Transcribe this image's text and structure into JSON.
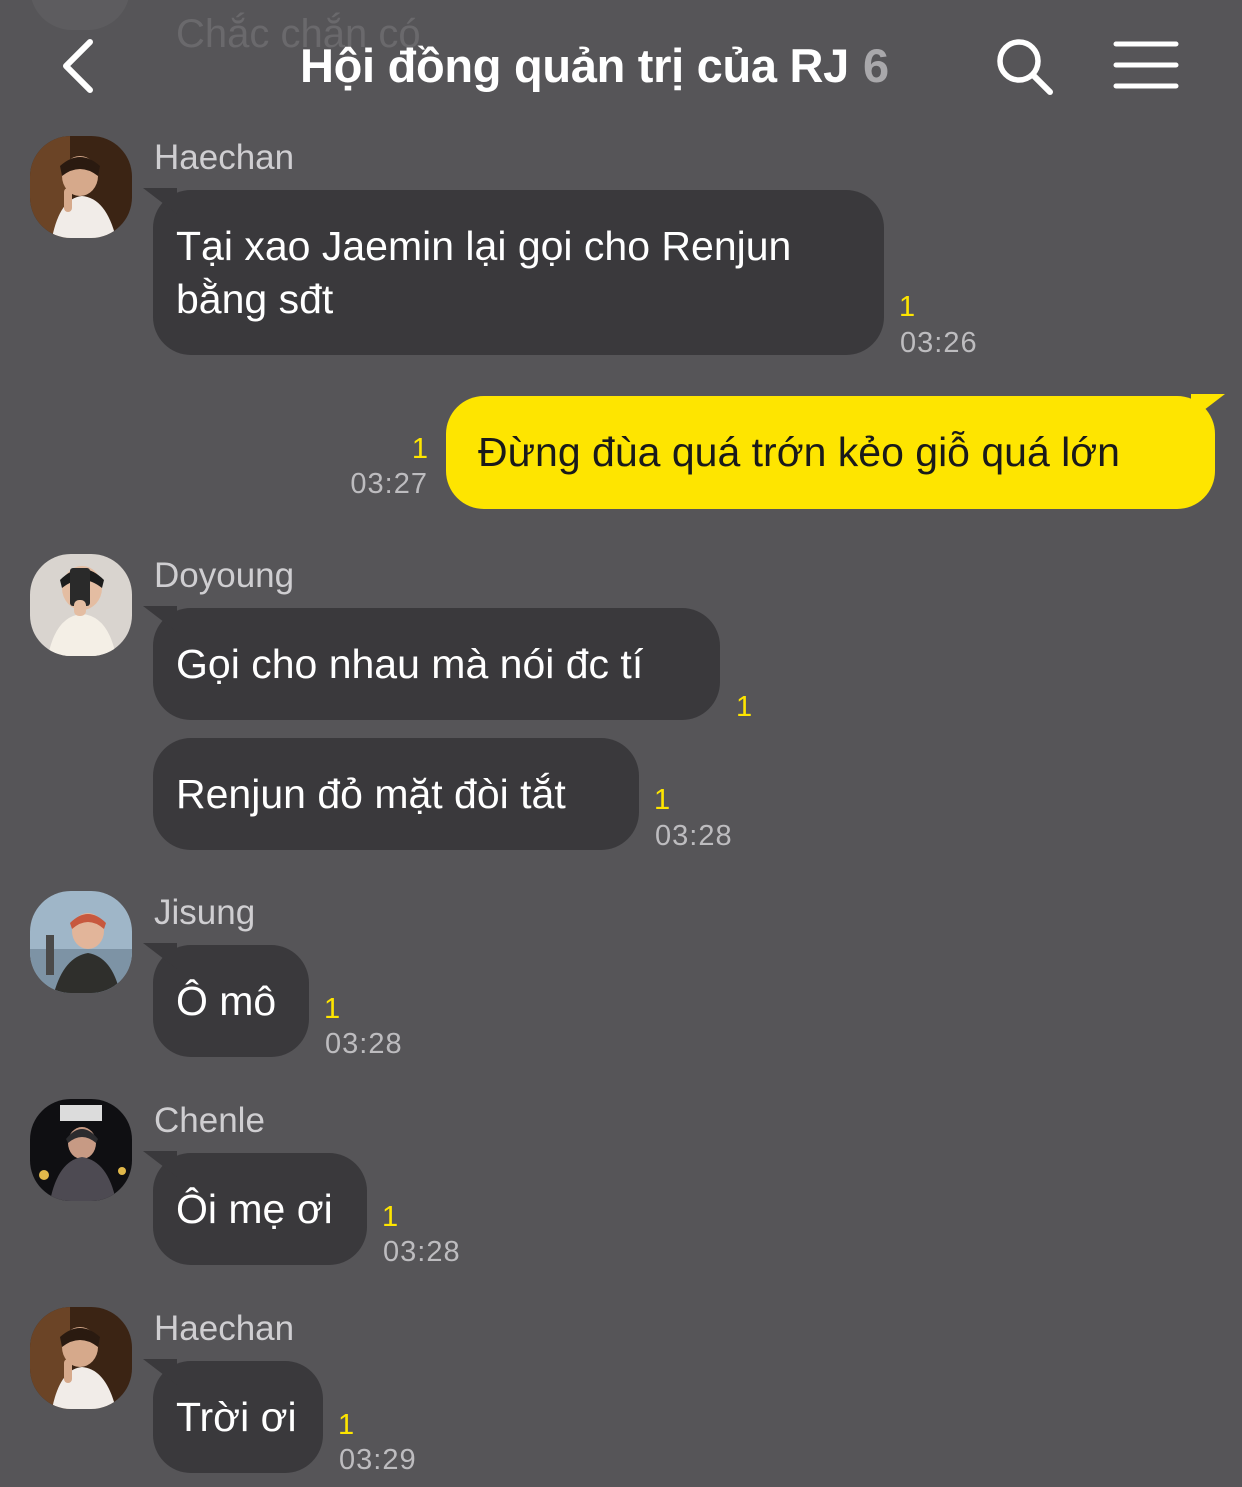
{
  "header": {
    "title": "Hội đồng quản trị của RJ",
    "member_count": "6",
    "ghost_preview": "Chắc chắn có"
  },
  "messages": [
    {
      "sender": "Haechan",
      "text_lines": [
        "Tại xao Jaemin lại gọi cho Renjun",
        "bằng sđt"
      ],
      "unread": "1",
      "time": "03:26"
    },
    {
      "sender": "",
      "mine": true,
      "text": "Đừng đùa quá trớn kẻo giỗ quá lớn",
      "unread": "1",
      "time": "03:27"
    },
    {
      "sender": "Doyoung",
      "text": "Gọi cho nhau mà nói đc tí",
      "unread": "1"
    },
    {
      "sender": "",
      "text": "Renjun đỏ mặt đòi tắt",
      "unread": "1",
      "time": "03:28"
    },
    {
      "sender": "Jisung",
      "text": "Ô mô",
      "unread": "1",
      "time": "03:28"
    },
    {
      "sender": "Chenle",
      "text": "Ôi mẹ ơi",
      "unread": "1",
      "time": "03:28"
    },
    {
      "sender": "Haechan",
      "text": "Trời ơi",
      "unread": "1",
      "time": "03:29"
    }
  ],
  "colors": {
    "background": "#565558",
    "incoming_bubble": "#3a393c",
    "outgoing_bubble": "#fee500",
    "unread_count": "#fee500"
  }
}
